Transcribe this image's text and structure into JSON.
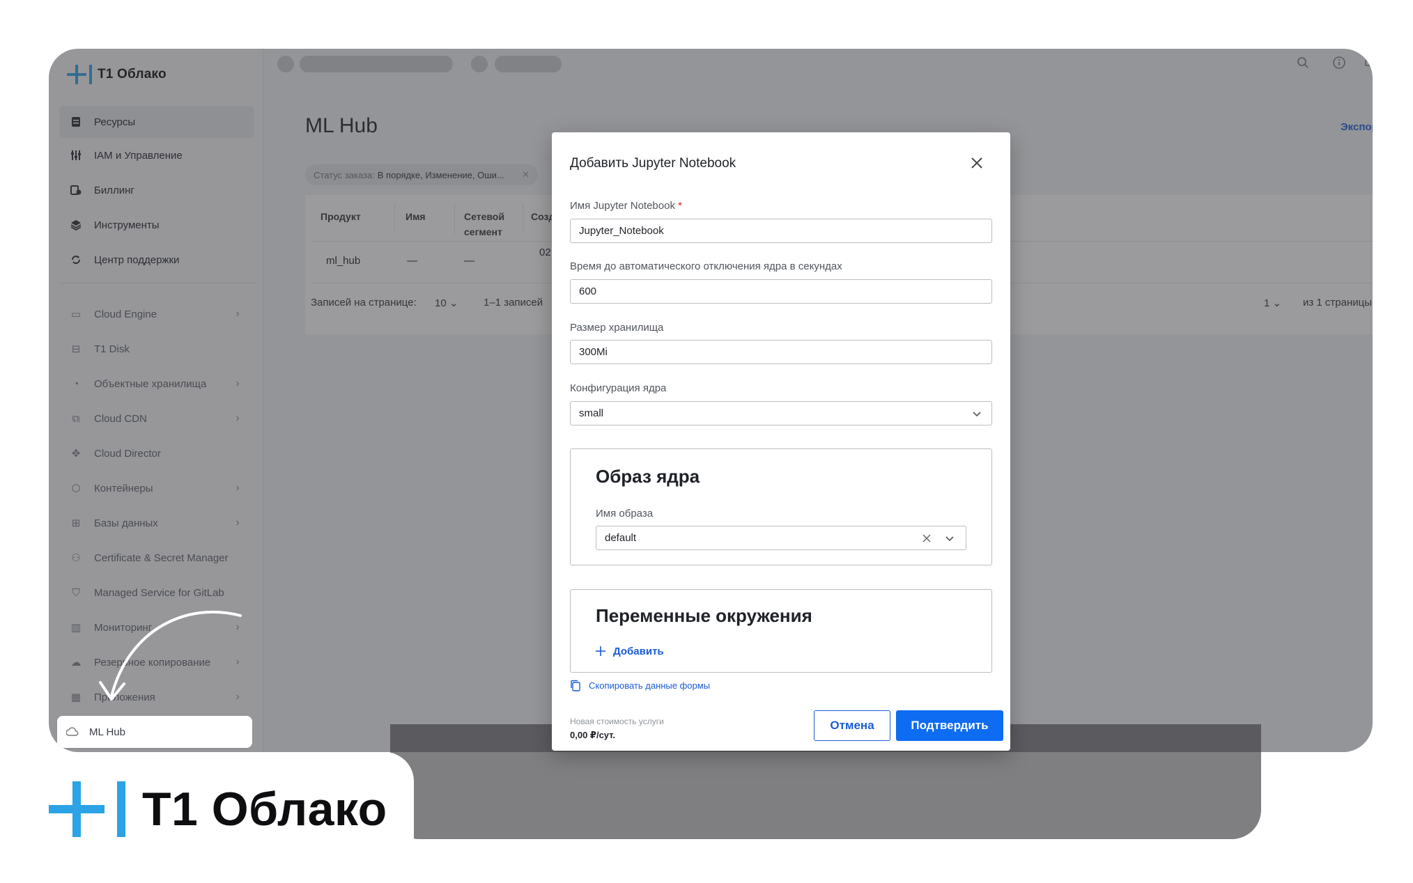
{
  "app": {
    "logo_text": "T1 Облако"
  },
  "sidebar": {
    "top_items": [
      {
        "label": "Ресурсы",
        "icon": "resources-icon"
      },
      {
        "label": "IAM и Управление",
        "icon": "iam-icon"
      },
      {
        "label": "Биллинг",
        "icon": "billing-icon"
      },
      {
        "label": "Инструменты",
        "icon": "tools-icon"
      },
      {
        "label": "Центр поддержки",
        "icon": "support-icon"
      }
    ],
    "services": [
      {
        "label": "Cloud Engine",
        "icon": "cloud-engine-icon",
        "chevron": true
      },
      {
        "label": "T1 Disk",
        "icon": "disk-icon",
        "chevron": false
      },
      {
        "label": "Объектные хранилища",
        "icon": "object-storage-icon",
        "chevron": true
      },
      {
        "label": "Cloud CDN",
        "icon": "cdn-icon",
        "chevron": true
      },
      {
        "label": "Cloud Director",
        "icon": "director-icon",
        "chevron": false
      },
      {
        "label": "Контейнеры",
        "icon": "containers-icon",
        "chevron": true
      },
      {
        "label": "Базы данных",
        "icon": "databases-icon",
        "chevron": true
      },
      {
        "label": "Certificate & Secret Manager",
        "icon": "certificate-icon",
        "chevron": false
      },
      {
        "label": "Managed Service for GitLab",
        "icon": "gitlab-icon",
        "chevron": false
      },
      {
        "label": "Мониторинг",
        "icon": "monitoring-icon",
        "chevron": true
      },
      {
        "label": "Резервное копирование",
        "icon": "backup-icon",
        "chevron": true
      },
      {
        "label": "Приложения",
        "icon": "apps-icon",
        "chevron": true
      }
    ],
    "highlighted_item": {
      "label": "ML Hub",
      "icon": "ml-hub-icon"
    }
  },
  "main": {
    "page_title": "ML Hub",
    "export_link": "Экспорт",
    "filter": {
      "label": "Статус заказа:",
      "value": "В порядке, Изменение, Оши..."
    },
    "table": {
      "headers": [
        "Продукт",
        "Имя",
        "Сетевой сегмент",
        "Создан"
      ],
      "rows": [
        {
          "product": "ml_hub",
          "name": "—",
          "segment": "—",
          "created": "02"
        }
      ]
    },
    "pager": {
      "per_page_label": "Записей на странице:",
      "per_page_value": "10",
      "range": "1–1 записей",
      "page": "1",
      "pages_label": "из 1 страницы"
    }
  },
  "modal": {
    "title": "Добавить Jupyter Notebook",
    "name_label": "Имя Jupyter Notebook",
    "name_required_mark": "*",
    "name_value": "Jupyter_Notebook",
    "timeout_label": "Время до автоматического отключения ядра в секундах",
    "timeout_value": "600",
    "storage_label": "Размер хранилища",
    "storage_value": "300Mi",
    "kernel_config_label": "Конфигурация ядра",
    "kernel_config_value": "small",
    "image_section": {
      "title": "Образ ядра",
      "image_name_label": "Имя образа",
      "image_name_value": "default"
    },
    "env_section": {
      "title": "Переменные окружения",
      "add_label": "Добавить"
    },
    "copy_form_label": "Скопировать данные формы",
    "cost_label": "Новая стоимость услуги",
    "cost_value": "0,00 ₽/сут.",
    "cancel_label": "Отмена",
    "confirm_label": "Подтвердить"
  },
  "brand": {
    "logo_text": "T1 Облако",
    "accent_color": "#2ba3e6",
    "primary_button_color": "#0d6cf2"
  }
}
